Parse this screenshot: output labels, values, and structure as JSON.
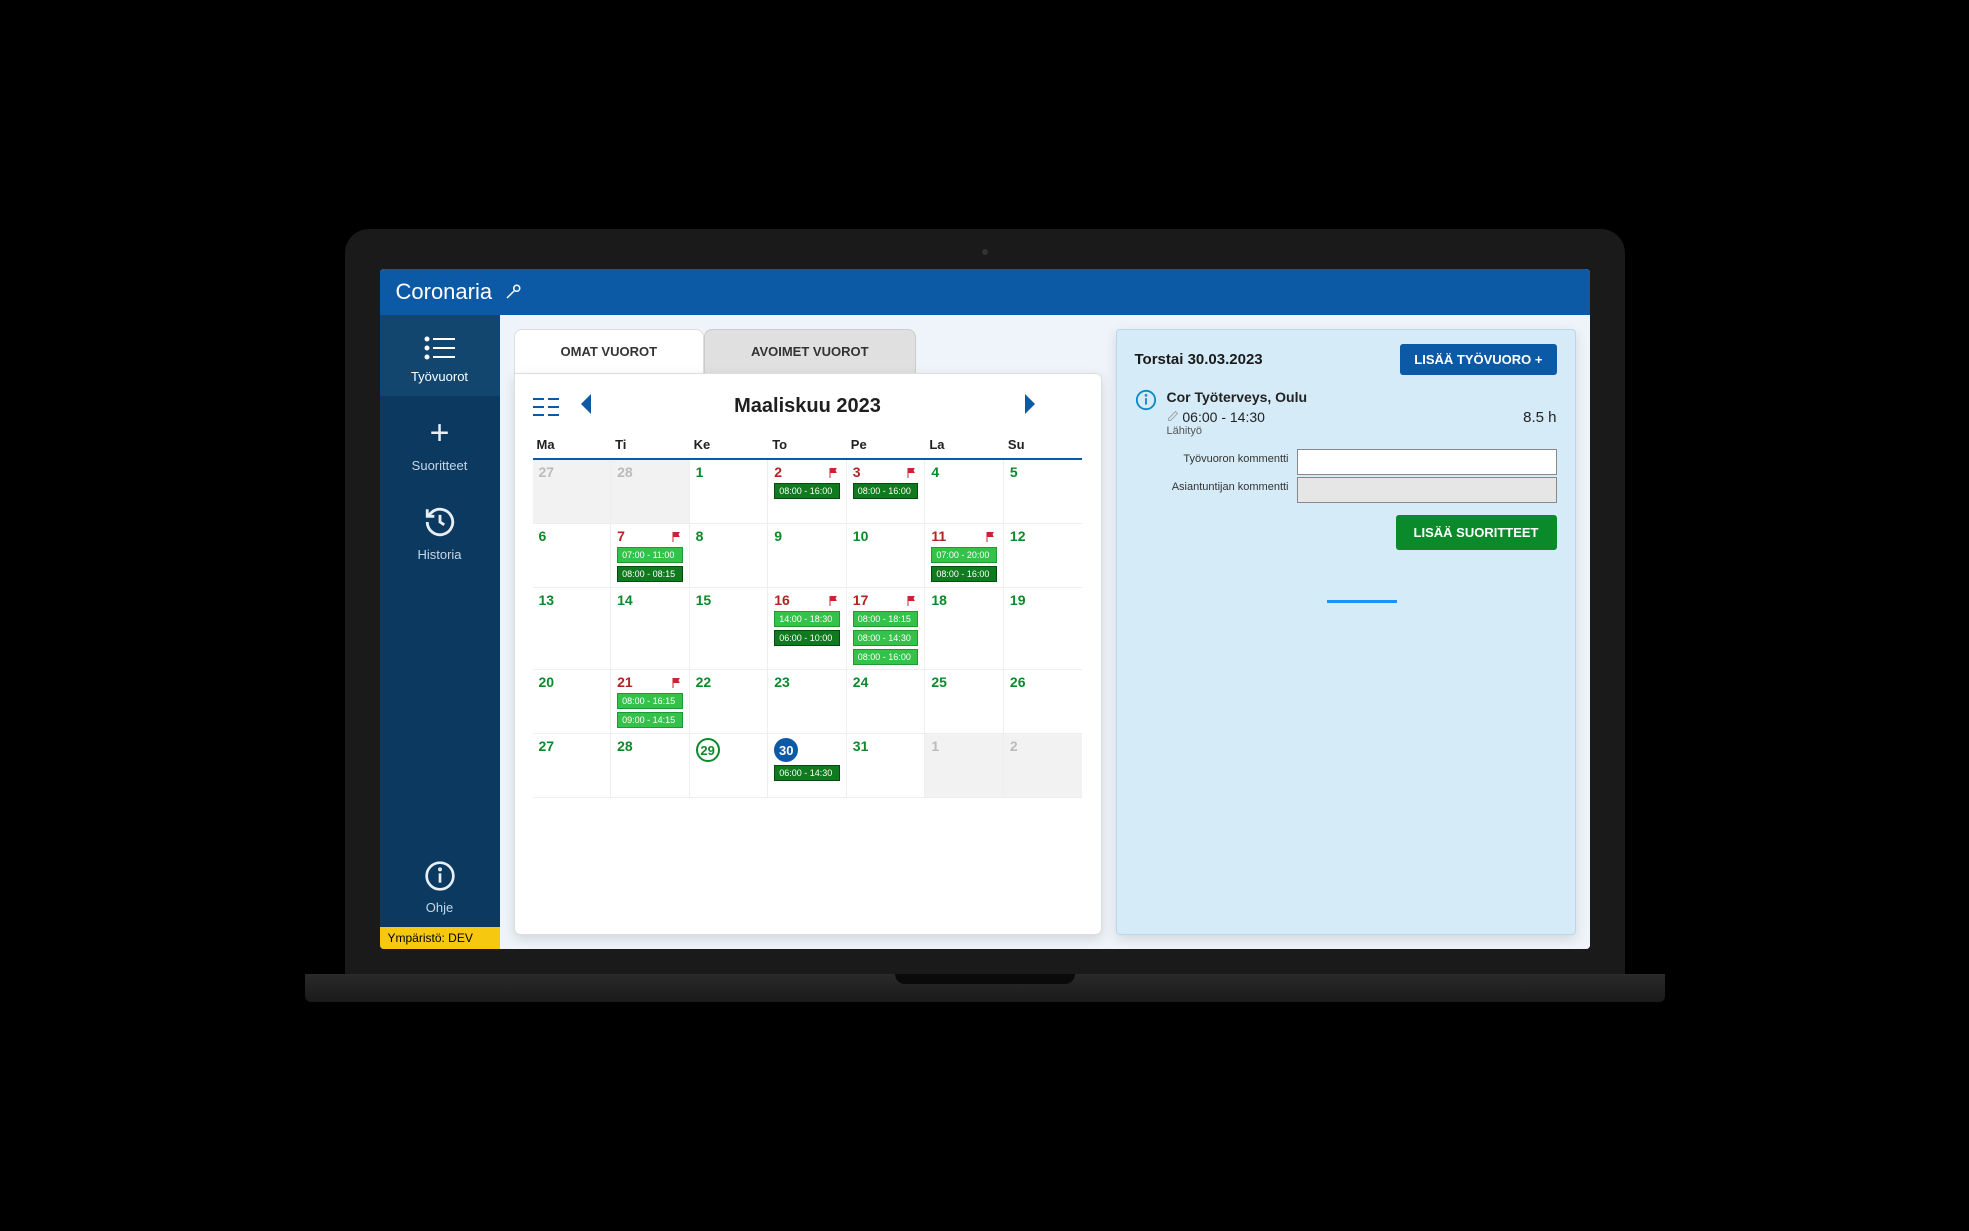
{
  "brand": "Coronaria",
  "sidebar": {
    "items": [
      {
        "label": "Työvuorot"
      },
      {
        "label": "Suoritteet"
      },
      {
        "label": "Historia"
      },
      {
        "label": "Ohje"
      }
    ],
    "env": "Ympäristö: DEV"
  },
  "tabs": {
    "own": "OMAT VUOROT",
    "open": "AVOIMET VUOROT"
  },
  "calendar": {
    "month": "Maaliskuu 2023",
    "days_of_week": [
      "Ma",
      "Ti",
      "Ke",
      "To",
      "Pe",
      "La",
      "Su"
    ],
    "cells": [
      {
        "n": "27",
        "other": true
      },
      {
        "n": "28",
        "other": true
      },
      {
        "n": "1",
        "c": "green"
      },
      {
        "n": "2",
        "c": "red",
        "flag": true,
        "chips": [
          {
            "t": "08:00 - 16:00"
          }
        ]
      },
      {
        "n": "3",
        "c": "red",
        "flag": true,
        "chips": [
          {
            "t": "08:00 - 16:00"
          }
        ]
      },
      {
        "n": "4",
        "c": "green"
      },
      {
        "n": "5",
        "c": "green"
      },
      {
        "n": "6",
        "c": "green"
      },
      {
        "n": "7",
        "c": "red",
        "flag": true,
        "chips": [
          {
            "t": "07:00 - 11:00",
            "l": true
          },
          {
            "t": "08:00 - 08:15"
          }
        ]
      },
      {
        "n": "8",
        "c": "green"
      },
      {
        "n": "9",
        "c": "green"
      },
      {
        "n": "10",
        "c": "green"
      },
      {
        "n": "11",
        "c": "red",
        "flag": true,
        "chips": [
          {
            "t": "07:00 - 20:00",
            "l": true
          },
          {
            "t": "08:00 - 16:00"
          }
        ]
      },
      {
        "n": "12",
        "c": "green"
      },
      {
        "n": "13",
        "c": "green"
      },
      {
        "n": "14",
        "c": "green"
      },
      {
        "n": "15",
        "c": "green"
      },
      {
        "n": "16",
        "c": "red",
        "flag": true,
        "chips": [
          {
            "t": "14:00 - 18:30",
            "l": true
          },
          {
            "t": "06:00 - 10:00"
          }
        ]
      },
      {
        "n": "17",
        "c": "red",
        "flag": true,
        "chips": [
          {
            "t": "08:00 - 18:15",
            "l": true
          },
          {
            "t": "08:00 - 14:30",
            "l": true
          },
          {
            "t": "08:00 - 16:00",
            "l": true
          }
        ]
      },
      {
        "n": "18",
        "c": "green"
      },
      {
        "n": "19",
        "c": "green"
      },
      {
        "n": "20",
        "c": "green"
      },
      {
        "n": "21",
        "c": "red",
        "flag": true,
        "chips": [
          {
            "t": "08:00 - 16:15",
            "l": true
          },
          {
            "t": "09:00 - 14:15",
            "l": true
          }
        ]
      },
      {
        "n": "22",
        "c": "green"
      },
      {
        "n": "23",
        "c": "green"
      },
      {
        "n": "24",
        "c": "green"
      },
      {
        "n": "25",
        "c": "green"
      },
      {
        "n": "26",
        "c": "green"
      },
      {
        "n": "27",
        "c": "green"
      },
      {
        "n": "28",
        "c": "green"
      },
      {
        "n": "29",
        "c": "green",
        "today": true
      },
      {
        "n": "30",
        "c": "green",
        "selected": true,
        "chips": [
          {
            "t": "06:00 - 14:30"
          }
        ]
      },
      {
        "n": "31",
        "c": "green"
      },
      {
        "n": "1",
        "other": true
      },
      {
        "n": "2",
        "other": true
      }
    ]
  },
  "detail": {
    "date": "Torstai 30.03.2023",
    "add_button": "LISÄÄ TYÖVUORO +",
    "shift": {
      "title": "Cor Työterveys, Oulu",
      "time": "06:00 - 14:30",
      "type": "Lähityö",
      "hours": "8.5 h"
    },
    "fields": {
      "comment1": "Työvuoron kommentti",
      "comment2": "Asiantuntijan kommentti"
    },
    "action": "LISÄÄ SUORITTEET"
  }
}
